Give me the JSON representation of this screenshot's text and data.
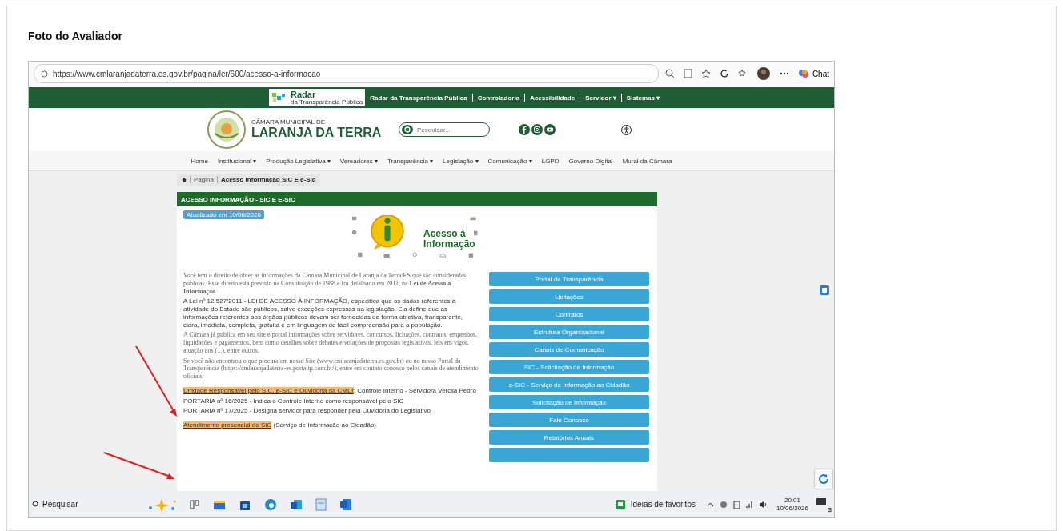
{
  "card": {
    "title": "Foto do Avaliador"
  },
  "browser": {
    "url": "https://www.cmlaranjadaterra.es.gov.br/pagina/ler/600/acesso-a-informacao",
    "chat_label": "Chat"
  },
  "site": {
    "radar_label": "Radar",
    "radar_sub": "da Transparência Pública",
    "top_links": [
      "Radar da Transparência Pública",
      "Controladoria",
      "Acessibilidade",
      "Servidor ▾",
      "Sistemas ▾"
    ],
    "org_small": "CÂMARA MUNICIPAL DE",
    "org_name": "LARANJA DA TERRA",
    "search_placeholder": "Pesquisar...",
    "nav": [
      "Home",
      "Institucional ▾",
      "Produção Legislativa ▾",
      "Vereadores ▾",
      "Transparência ▾",
      "Legislação ▾",
      "Comunicação ▾",
      "LGPD",
      "Governo Digital",
      "Mural da Câmara"
    ],
    "breadcrumb": [
      "Página",
      "Acesso Informação SIC E e-Sic"
    ],
    "section_title": "ACESSO INFORMAÇÃO - SIC E E-SIC",
    "badge": "Atualizado em 10/06/2026",
    "logo_text": "Acesso à Informação",
    "paragraphs": [
      {
        "kind": "serif",
        "text": "Você tem o direito de obter as informações da Câmara Municipal de Laranja da Terra/ES que são consideradas públicas. Esse direito está previsto na Constituição de 1988 e foi detalhado em 2011, na **Lei de Acesso à Informação**."
      },
      {
        "kind": "sans",
        "text": "A Lei nº 12.527/2011 - LEI DE ACESSO À INFORMAÇÃO, especifica que os dados referentes à atividade do Estado são públicos, salvo exceções expressas na legislação. Ela define que as informações referentes aos órgãos públicos devem ser fornecidas de forma objetiva, transparente, clara, imediata, completa, gratuita e em linguagem de fácil compreensão para a população."
      },
      {
        "kind": "serif",
        "text": "A Câmara já publica em seu site e portal informações sobre servidores, concursos, licitações, contratos, empenhos, liquidações e pagamentos, bem como detalhes sobre debates e votações de propostas legislativas, leis em vigor, atuação dos (...), entre outros."
      },
      {
        "kind": "serif",
        "text": "Se você não encontrou o que procura em nosso Site (www.cmlaranjadaterra.es.gov.br) ou no nosso Portal da Transparência (https://cmlaranjadaterra-es.portaltp.com.br/), entre em contato conosco pelos canais de atendimento oficiais."
      },
      {
        "kind": "highlight",
        "text": "**Unidade Responsável pelo SIC, e-SIC e Ouvidoria da CMLT**: Controle Interno - Servidora Vercila Pedro"
      },
      {
        "kind": "sans",
        "text": "PORTARIA nº 16/2025 - Indica o Controle Interno como responsável pelo SIC"
      },
      {
        "kind": "sans",
        "text": "PORTARIA nº 17/2025 - Designa servidor para responder pela Ouvidoria do Legislativo"
      },
      {
        "kind": "highlight",
        "text": "**Atendimento presencial do SIC** (Serviço de Informação ao Cidadão)"
      }
    ],
    "links": [
      "Portal da Transparência",
      "Licitações",
      "Contratos",
      "Estrutura Organizacional",
      "Canais de Comunicação",
      "SIC - Solicitação de Informação",
      "e-SIC - Serviço de Informação ao Cidadão",
      "Solicitação de Informação",
      "Fale Conosco",
      "Relatórios Anuais"
    ]
  },
  "taskbar": {
    "search": "Pesquisar",
    "news": "Ideias de favoritos",
    "time": "20:01",
    "date": "10/06/2026",
    "notifications": "3"
  }
}
